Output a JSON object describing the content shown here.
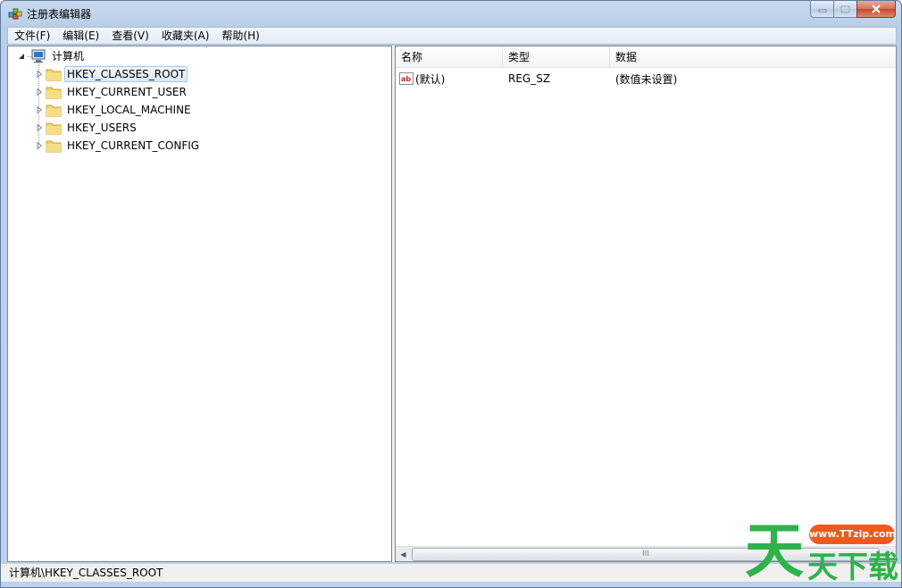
{
  "window": {
    "title": "注册表编辑器",
    "icon": "registry-editor-icon"
  },
  "menu": [
    {
      "label": "文件(F)"
    },
    {
      "label": "编辑(E)"
    },
    {
      "label": "查看(V)"
    },
    {
      "label": "收藏夹(A)"
    },
    {
      "label": "帮助(H)"
    }
  ],
  "tree": {
    "root": {
      "label": "计算机",
      "icon": "computer-icon",
      "expanded": true
    },
    "children": [
      {
        "label": "HKEY_CLASSES_ROOT",
        "selected": true
      },
      {
        "label": "HKEY_CURRENT_USER"
      },
      {
        "label": "HKEY_LOCAL_MACHINE"
      },
      {
        "label": "HKEY_USERS"
      },
      {
        "label": "HKEY_CURRENT_CONFIG"
      }
    ]
  },
  "list": {
    "columns": [
      "名称",
      "类型",
      "数据"
    ],
    "rows": [
      {
        "name": "(默认)",
        "type": "REG_SZ",
        "data": "(数值未设置)",
        "icon": "string-value-icon"
      }
    ],
    "thumb_grip": "III"
  },
  "status": {
    "path": "计算机\\HKEY_CLASSES_ROOT"
  },
  "watermark": {
    "url": "www.TTzip.com",
    "chars": [
      "天",
      "天",
      "下",
      "载"
    ]
  },
  "colors": {
    "folder": "#f0c840",
    "watermark_green": "#2db34a",
    "watermark_orange": "#ee5a1e"
  }
}
